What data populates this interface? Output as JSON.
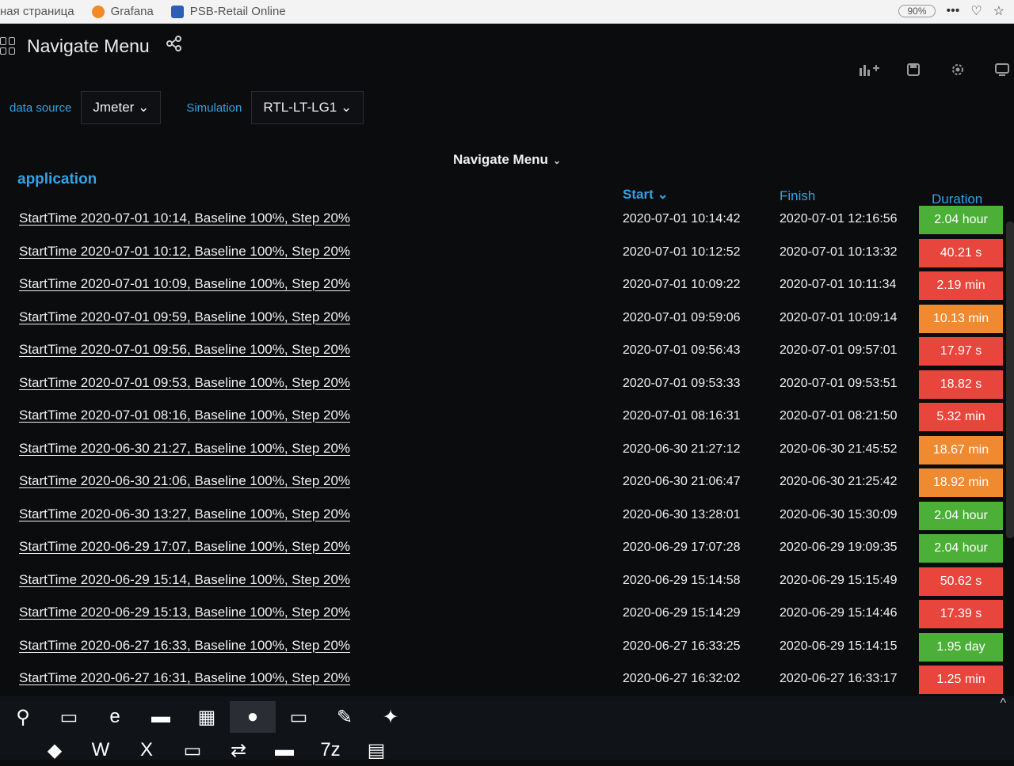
{
  "browser": {
    "bookmarks": [
      {
        "label": "ная страница",
        "color": "#777777"
      },
      {
        "label": "Grafana",
        "color": "#f38a25"
      },
      {
        "label": "PSB-Retail Online",
        "color": "#2b5fb8"
      }
    ],
    "zoom": "90%",
    "menu": "•••",
    "pocket_icon": "♡",
    "star_icon": "☆"
  },
  "header": {
    "title": "Navigate Menu",
    "grid_icon": "grid-icon",
    "share_icon": "share-icon",
    "toolbar_icons": [
      "add-panel-icon",
      "save-icon",
      "settings-icon",
      "tv-mode-icon"
    ]
  },
  "variables": {
    "data_source_label": "data source",
    "data_source_value": "Jmeter ⌄",
    "simulation_label": "Simulation",
    "simulation_value": "RTL-LT-LG1 ⌄"
  },
  "panel": {
    "title": "Navigate Menu",
    "title_chevron": "⌄",
    "columns": {
      "application": "application",
      "start": "Start ⌄",
      "finish": "Finish",
      "duration": "Duration"
    },
    "rows": [
      {
        "app": "StartTime 2020-07-01 10:14, Baseline 100%, Step 20%",
        "start": "2020-07-01 10:14:42",
        "finish": "2020-07-01 12:16:56",
        "duration": "2.04 hour",
        "color": "#4caf38"
      },
      {
        "app": "StartTime 2020-07-01 10:12, Baseline 100%, Step 20%",
        "start": "2020-07-01 10:12:52",
        "finish": "2020-07-01 10:13:32",
        "duration": "40.21 s",
        "color": "#e8453c"
      },
      {
        "app": "StartTime 2020-07-01 10:09, Baseline 100%, Step 20%",
        "start": "2020-07-01 10:09:22",
        "finish": "2020-07-01 10:11:34",
        "duration": "2.19 min",
        "color": "#e8453c"
      },
      {
        "app": "StartTime 2020-07-01 09:59, Baseline 100%, Step 20%",
        "start": "2020-07-01 09:59:06",
        "finish": "2020-07-01 10:09:14",
        "duration": "10.13 min",
        "color": "#ef8a30"
      },
      {
        "app": "StartTime 2020-07-01 09:56, Baseline 100%, Step 20%",
        "start": "2020-07-01 09:56:43",
        "finish": "2020-07-01 09:57:01",
        "duration": "17.97 s",
        "color": "#e8453c"
      },
      {
        "app": "StartTime 2020-07-01 09:53, Baseline 100%, Step 20%",
        "start": "2020-07-01 09:53:33",
        "finish": "2020-07-01 09:53:51",
        "duration": "18.82 s",
        "color": "#e8453c"
      },
      {
        "app": "StartTime 2020-07-01 08:16, Baseline 100%, Step 20%",
        "start": "2020-07-01 08:16:31",
        "finish": "2020-07-01 08:21:50",
        "duration": "5.32 min",
        "color": "#e8453c"
      },
      {
        "app": "StartTime 2020-06-30 21:27, Baseline 100%, Step 20%",
        "start": "2020-06-30 21:27:12",
        "finish": "2020-06-30 21:45:52",
        "duration": "18.67 min",
        "color": "#ef8a30"
      },
      {
        "app": "StartTime 2020-06-30 21:06, Baseline 100%, Step 20%",
        "start": "2020-06-30 21:06:47",
        "finish": "2020-06-30 21:25:42",
        "duration": "18.92 min",
        "color": "#ef8a30"
      },
      {
        "app": "StartTime 2020-06-30 13:27, Baseline 100%, Step 20%",
        "start": "2020-06-30 13:28:01",
        "finish": "2020-06-30 15:30:09",
        "duration": "2.04 hour",
        "color": "#4caf38"
      },
      {
        "app": "StartTime 2020-06-29 17:07, Baseline 100%, Step 20%",
        "start": "2020-06-29 17:07:28",
        "finish": "2020-06-29 19:09:35",
        "duration": "2.04 hour",
        "color": "#4caf38"
      },
      {
        "app": "StartTime 2020-06-29 15:14, Baseline 100%, Step 20%",
        "start": "2020-06-29 15:14:58",
        "finish": "2020-06-29 15:15:49",
        "duration": "50.62 s",
        "color": "#e8453c"
      },
      {
        "app": "StartTime 2020-06-29 15:13, Baseline 100%, Step 20%",
        "start": "2020-06-29 15:14:29",
        "finish": "2020-06-29 15:14:46",
        "duration": "17.39 s",
        "color": "#e8453c"
      },
      {
        "app": "StartTime 2020-06-27 16:33, Baseline 100%, Step 20%",
        "start": "2020-06-27 16:33:25",
        "finish": "2020-06-29 15:14:15",
        "duration": "1.95 day",
        "color": "#4caf38"
      },
      {
        "app": "StartTime 2020-06-27 16:31, Baseline 100%, Step 20%",
        "start": "2020-06-27 16:32:02",
        "finish": "2020-06-27 16:33:17",
        "duration": "1.25 min",
        "color": "#e8453c"
      }
    ]
  },
  "taskbar": {
    "row1": [
      {
        "name": "search-icon",
        "glyph": "⚲"
      },
      {
        "name": "task-view-icon",
        "glyph": "▭"
      },
      {
        "name": "internet-explorer-icon",
        "glyph": "e"
      },
      {
        "name": "file-explorer-icon",
        "glyph": "▬"
      },
      {
        "name": "notepad-icon",
        "glyph": "▦"
      },
      {
        "name": "firefox-icon",
        "glyph": "●"
      },
      {
        "name": "terminal-icon",
        "glyph": "▭"
      },
      {
        "name": "pen-icon",
        "glyph": "✎"
      },
      {
        "name": "paint-icon",
        "glyph": "✦"
      }
    ],
    "row2": [
      {
        "name": "windows-app-icon",
        "glyph": "◆"
      },
      {
        "name": "word-icon",
        "glyph": "W"
      },
      {
        "name": "excel-icon",
        "glyph": "X"
      },
      {
        "name": "terminal-icon-2",
        "glyph": "▭"
      },
      {
        "name": "network-icon",
        "glyph": "⇄"
      },
      {
        "name": "folder-icon",
        "glyph": "▬"
      },
      {
        "name": "7zip-icon",
        "glyph": "7z"
      },
      {
        "name": "document-icon",
        "glyph": "▤"
      }
    ],
    "tray_icon": "^"
  }
}
